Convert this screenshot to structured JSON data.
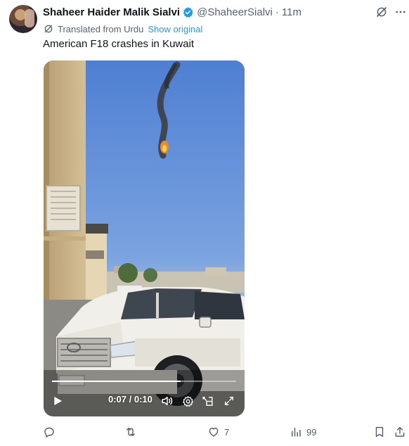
{
  "author": {
    "name": "Shaheer Haider Malik Sialvi",
    "handle": "@ShaheerSialvi",
    "separator": "·",
    "time": "11m"
  },
  "translation": {
    "label": "Translated from Urdu",
    "link": "Show original"
  },
  "tweet": {
    "text": "American F18 crashes in Kuwait"
  },
  "video": {
    "timecode": "0:07 / 0:10",
    "progress": 0.7
  },
  "actions": {
    "likes": "7",
    "views": "99"
  },
  "colors": {
    "accent": "#1d9bf0",
    "muted": "#536471",
    "text": "#0f1419"
  },
  "icons": [
    "verified-badge-icon",
    "grok-icon",
    "more-icon",
    "translate-icon",
    "play-icon",
    "volume-icon",
    "settings-icon",
    "pip-icon",
    "fullscreen-icon",
    "reply-icon",
    "retweet-icon",
    "like-icon",
    "views-icon",
    "bookmark-icon",
    "share-icon"
  ]
}
